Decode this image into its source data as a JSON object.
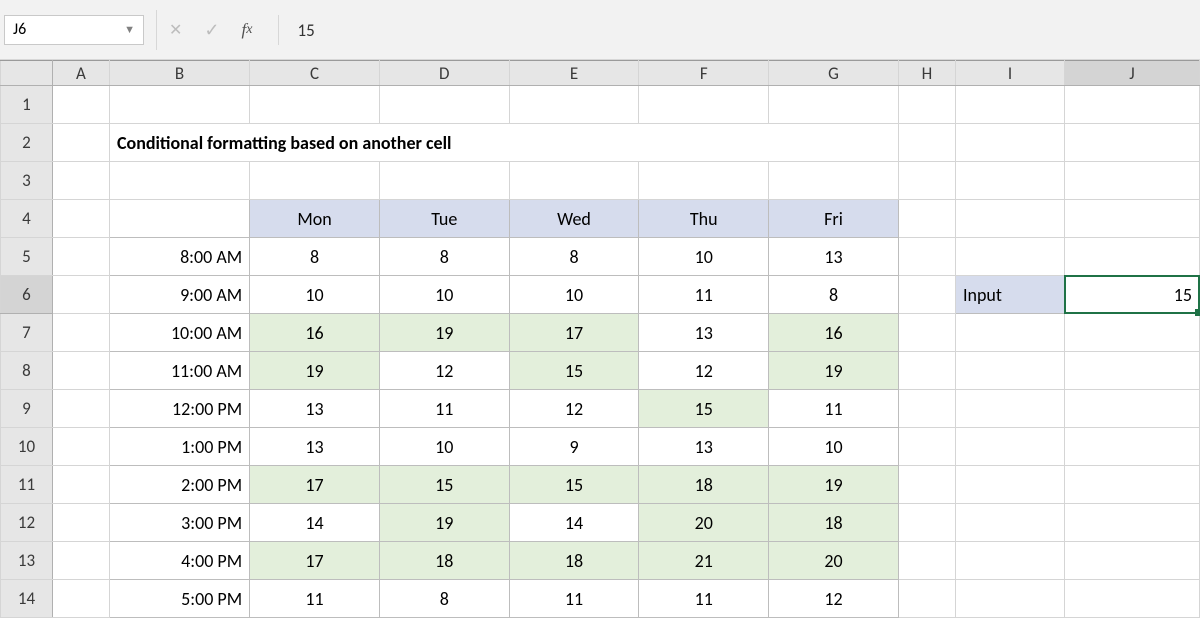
{
  "formula_bar": {
    "name_box": "J6",
    "value": "15"
  },
  "columns": [
    "A",
    "B",
    "C",
    "D",
    "E",
    "F",
    "G",
    "H",
    "I",
    "J"
  ],
  "rows": [
    "1",
    "2",
    "3",
    "4",
    "5",
    "6",
    "7",
    "8",
    "9",
    "10",
    "11",
    "12",
    "13",
    "14"
  ],
  "title": "Conditional formatting based on another cell",
  "table": {
    "headers": [
      "Mon",
      "Tue",
      "Wed",
      "Thu",
      "Fri"
    ],
    "times": [
      "8:00 AM",
      "9:00 AM",
      "10:00 AM",
      "11:00 AM",
      "12:00 PM",
      "1:00 PM",
      "2:00 PM",
      "3:00 PM",
      "4:00 PM",
      "5:00 PM"
    ],
    "data": [
      [
        8,
        8,
        8,
        10,
        13
      ],
      [
        10,
        10,
        10,
        11,
        8
      ],
      [
        16,
        19,
        17,
        13,
        16
      ],
      [
        19,
        12,
        15,
        12,
        19
      ],
      [
        13,
        11,
        12,
        15,
        11
      ],
      [
        13,
        10,
        9,
        13,
        10
      ],
      [
        17,
        15,
        15,
        18,
        19
      ],
      [
        14,
        19,
        14,
        20,
        18
      ],
      [
        17,
        18,
        18,
        21,
        20
      ],
      [
        11,
        8,
        11,
        11,
        12
      ]
    ]
  },
  "input": {
    "label": "Input",
    "value": 15
  },
  "active_row": "6",
  "active_col": "J"
}
